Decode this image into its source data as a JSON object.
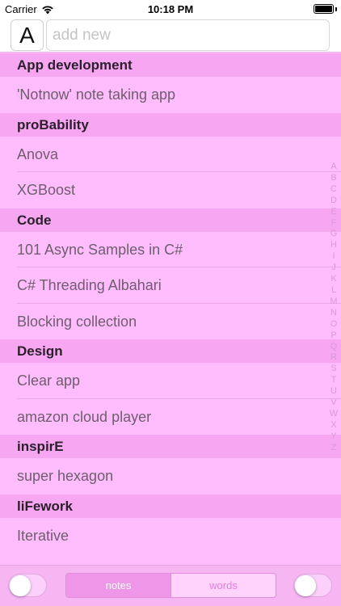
{
  "status_bar": {
    "carrier": "Carrier",
    "time": "10:18 PM"
  },
  "header": {
    "az_label": "A",
    "add_placeholder": "add new",
    "add_value": ""
  },
  "sections": [
    {
      "title": "App development",
      "items": [
        "'Notnow' note taking app"
      ]
    },
    {
      "title": "proBability",
      "items": [
        "Anova",
        "XGBoost"
      ]
    },
    {
      "title": "Code",
      "items": [
        "101 Async Samples in C#",
        "C# Threading Albahari",
        "Blocking collection"
      ]
    },
    {
      "title": "Design",
      "items": [
        "Clear app",
        "amazon cloud player"
      ]
    },
    {
      "title": "inspirE",
      "items": [
        "super hexagon"
      ]
    },
    {
      "title": "liFework",
      "items": [
        "Iterative"
      ]
    }
  ],
  "index_letters": [
    "A",
    "B",
    "C",
    "D",
    "E",
    "F",
    "G",
    "H",
    "I",
    "J",
    "K",
    "L",
    "M",
    "N",
    "O",
    "P",
    "Q",
    "R",
    "S",
    "T",
    "U",
    "V",
    "W",
    "X",
    "Y",
    "Z"
  ],
  "bottom_bar": {
    "tab_notes": "notes",
    "tab_words": "words",
    "active_tab": "notes"
  },
  "colors": {
    "background": "#ffbdfd",
    "section_header": "#f7a6f2",
    "segment_active": "#ee96e8"
  },
  "icons": {
    "signal": "wifi-icon",
    "battery": "battery-icon"
  }
}
